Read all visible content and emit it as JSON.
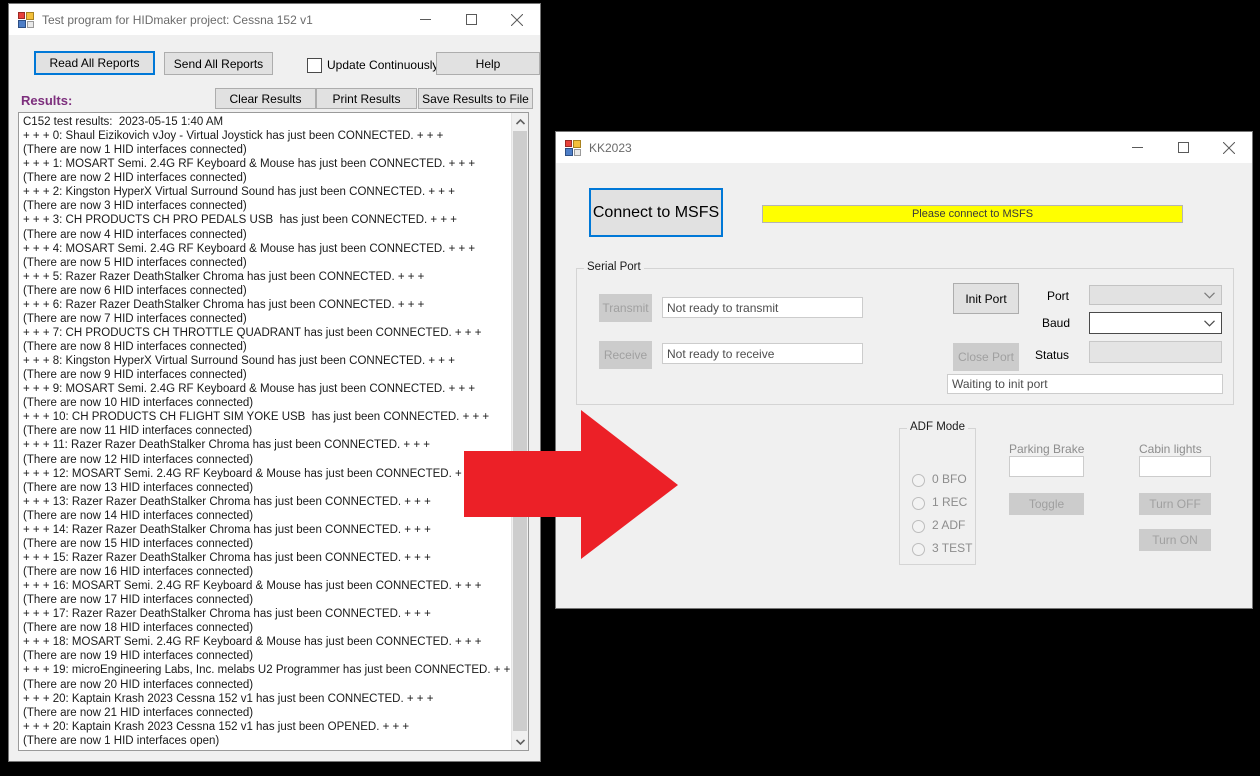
{
  "windows": {
    "hidmaker": {
      "title": "Test program for HIDmaker project: Cessna 152 v1",
      "icon": "app-icon",
      "controls": {
        "minimize": "minimize-icon",
        "maximize": "maximize-icon",
        "close": "close-icon"
      },
      "toolbar": {
        "read_all_reports": "Read All Reports",
        "send_all_reports": "Send All Reports",
        "update_continuously": "Update Continuously",
        "help": "Help",
        "clear_results": "Clear Results",
        "print_results": "Print Results",
        "save_results": "Save Results to File"
      },
      "results_label": "Results:",
      "results_text": "C152 test results:  2023-05-15 1:40 AM\n+ + + 0: Shaul Eizikovich vJoy - Virtual Joystick has just been CONNECTED. + + +\n(There are now 1 HID interfaces connected)\n+ + + 1: MOSART Semi. 2.4G RF Keyboard & Mouse has just been CONNECTED. + + +\n(There are now 2 HID interfaces connected)\n+ + + 2: Kingston HyperX Virtual Surround Sound has just been CONNECTED. + + +\n(There are now 3 HID interfaces connected)\n+ + + 3: CH PRODUCTS CH PRO PEDALS USB  has just been CONNECTED. + + +\n(There are now 4 HID interfaces connected)\n+ + + 4: MOSART Semi. 2.4G RF Keyboard & Mouse has just been CONNECTED. + + +\n(There are now 5 HID interfaces connected)\n+ + + 5: Razer Razer DeathStalker Chroma has just been CONNECTED. + + +\n(There are now 6 HID interfaces connected)\n+ + + 6: Razer Razer DeathStalker Chroma has just been CONNECTED. + + +\n(There are now 7 HID interfaces connected)\n+ + + 7: CH PRODUCTS CH THROTTLE QUADRANT has just been CONNECTED. + + +\n(There are now 8 HID interfaces connected)\n+ + + 8: Kingston HyperX Virtual Surround Sound has just been CONNECTED. + + +\n(There are now 9 HID interfaces connected)\n+ + + 9: MOSART Semi. 2.4G RF Keyboard & Mouse has just been CONNECTED. + + +\n(There are now 10 HID interfaces connected)\n+ + + 10: CH PRODUCTS CH FLIGHT SIM YOKE USB  has just been CONNECTED. + + +\n(There are now 11 HID interfaces connected)\n+ + + 11: Razer Razer DeathStalker Chroma has just been CONNECTED. + + +\n(There are now 12 HID interfaces connected)\n+ + + 12: MOSART Semi. 2.4G RF Keyboard & Mouse has just been CONNECTED. + + +\n(There are now 13 HID interfaces connected)\n+ + + 13: Razer Razer DeathStalker Chroma has just been CONNECTED. + + +\n(There are now 14 HID interfaces connected)\n+ + + 14: Razer Razer DeathStalker Chroma has just been CONNECTED. + + +\n(There are now 15 HID interfaces connected)\n+ + + 15: Razer Razer DeathStalker Chroma has just been CONNECTED. + + +\n(There are now 16 HID interfaces connected)\n+ + + 16: MOSART Semi. 2.4G RF Keyboard & Mouse has just been CONNECTED. + + +\n(There are now 17 HID interfaces connected)\n+ + + 17: Razer Razer DeathStalker Chroma has just been CONNECTED. + + +\n(There are now 18 HID interfaces connected)\n+ + + 18: MOSART Semi. 2.4G RF Keyboard & Mouse has just been CONNECTED. + + +\n(There are now 19 HID interfaces connected)\n+ + + 19: microEngineering Labs, Inc. melabs U2 Programmer has just been CONNECTED. + + +\n(There are now 20 HID interfaces connected)\n+ + + 20: Kaptain Krash 2023 Cessna 152 v1 has just been CONNECTED. + + +\n(There are now 21 HID interfaces connected)\n+ + + 20: Kaptain Krash 2023 Cessna 152 v1 has just been OPENED. + + +\n(There are now 1 HID interfaces open)"
    },
    "kk2023": {
      "title": "KK2023",
      "icon": "app-icon",
      "controls": {
        "minimize": "minimize-icon",
        "maximize": "maximize-icon",
        "close": "close-icon"
      },
      "connect_button": "Connect to MSFS",
      "connect_status": "Please connect to MSFS",
      "serial_port": {
        "group_title": "Serial Port",
        "transmit_button": "Transmit",
        "transmit_status": "Not ready to transmit",
        "receive_button": "Receive",
        "receive_status": "Not ready to receive",
        "init_port_button": "Init Port",
        "close_port_button": "Close Port",
        "port_label": "Port",
        "port_value": "",
        "baud_label": "Baud",
        "baud_value": "",
        "status_label": "Status",
        "status_value": "",
        "port_state": "Waiting to init port"
      },
      "adf_mode": {
        "group_title": "ADF Mode",
        "options": [
          "0 BFO",
          "1 REC",
          "2 ADF",
          "3 TEST"
        ],
        "selected": null
      },
      "parking_brake": {
        "label": "Parking Brake",
        "value": "",
        "toggle_button": "Toggle"
      },
      "cabin_lights": {
        "label": "Cabin lights",
        "value": "",
        "turn_off_button": "Turn OFF",
        "turn_on_button": "Turn ON"
      }
    }
  },
  "annotation": {
    "arrow": "red-right-arrow"
  },
  "colors": {
    "accent": "#0078d7",
    "status_highlight": "#ffff00",
    "results_label": "#7d2f7d",
    "arrow": "#ec2027",
    "window_bg": "#f0f0f0",
    "desktop_bg": "#000000"
  }
}
